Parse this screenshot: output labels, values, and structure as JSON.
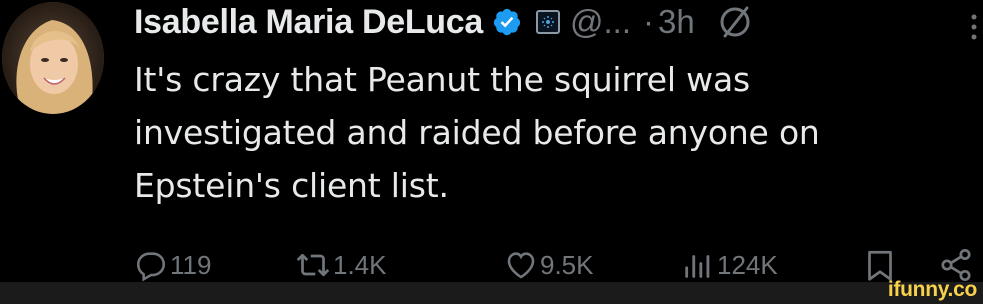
{
  "author": {
    "display_name": "Isabella Maria DeLuca",
    "handle": "@...",
    "separator": "·",
    "timestamp": "3h",
    "verified_icon": "verified-badge-icon",
    "affiliate_icon": "affiliate-badge-icon"
  },
  "tweet": {
    "lines": [
      "It's crazy that Peanut the squirrel was",
      "investigated and raided before anyone on",
      "Epstein's client list."
    ]
  },
  "actions": {
    "replies": "119",
    "reposts": "1.4K",
    "likes": "9.5K",
    "views": "124K"
  },
  "watermark": {
    "text": "ifunny.co"
  },
  "colors": {
    "background": "#000000",
    "text": "#e7e9ea",
    "secondary": "#71767b",
    "verified_blue": "#1d9bf0",
    "watermark_yellow": "#f8d14b",
    "banner": "#1b1b1b"
  }
}
